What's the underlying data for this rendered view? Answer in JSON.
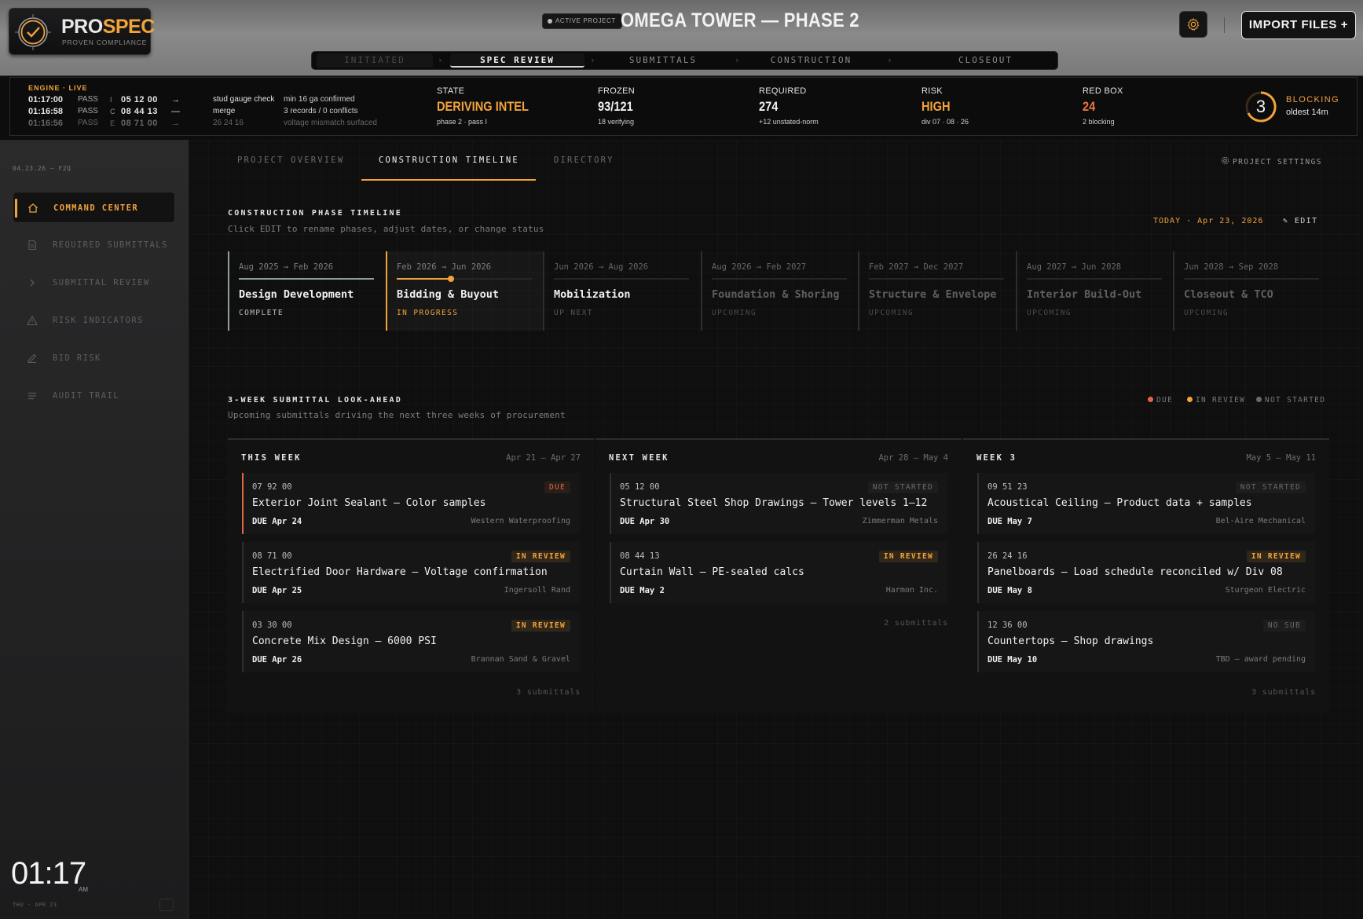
{
  "brand": {
    "name_a": "PRO",
    "name_b": "SPEC",
    "tagline": "PROVEN COMPLIANCE",
    "accent": "#f2a33a"
  },
  "header": {
    "active_badge": "ACTIVE PROJECT",
    "project_title": "OMEGA TOWER — PHASE 2",
    "import_label": "IMPORT FILES +",
    "settings_icon": "gear-icon"
  },
  "stepper": {
    "steps": [
      {
        "label": "INITIATED",
        "state": "done"
      },
      {
        "label": "SPEC REVIEW",
        "state": "active"
      },
      {
        "label": "SUBMITTALS",
        "state": "pending"
      },
      {
        "label": "CONSTRUCTION",
        "state": "pending"
      },
      {
        "label": "CLOSEOUT",
        "state": "pending"
      }
    ],
    "separator": "›"
  },
  "engine": {
    "label": "ENGINE · LIVE",
    "log": [
      {
        "time": "01:17:00",
        "status": "PASS",
        "code": "I",
        "num": "05 12 00",
        "arrow": "→",
        "msg": "stud gauge check",
        "detail": "min 16 ga confirmed"
      },
      {
        "time": "01:16:58",
        "status": "PASS",
        "code": "C",
        "num": "08 44 13",
        "arrow": "—",
        "msg": "merge",
        "detail": "3 records / 0 conflicts"
      },
      {
        "time": "01:16:56",
        "status": "PASS",
        "code": "E",
        "num": "08 71 00",
        "arrow": "→",
        "msg": "26 24 16",
        "detail": "voltage mismatch surfaced"
      }
    ]
  },
  "stats": [
    {
      "label": "STATE",
      "value": "DERIVING INTEL",
      "sub": "phase 2 · pass I",
      "tone": "orange"
    },
    {
      "label": "FROZEN",
      "value": "93/121",
      "sub": "18 verifying",
      "tone": "white"
    },
    {
      "label": "REQUIRED",
      "value": "274",
      "sub": "+12 unstated-norm",
      "tone": "white"
    },
    {
      "label": "RISK",
      "value": "HIGH",
      "sub": "div 07 · 08 · 26",
      "tone": "orange"
    },
    {
      "label": "RED BOX",
      "value": "24",
      "sub": "2 blocking",
      "tone": "red"
    }
  ],
  "blocking": {
    "count": "3",
    "label": "BLOCKING",
    "sub": "oldest 14m"
  },
  "sidebar": {
    "meta": "04.23.26 — F2Q",
    "items": [
      {
        "label": "COMMAND CENTER",
        "icon": "home-icon",
        "active": true
      },
      {
        "label": "REQUIRED SUBMITTALS",
        "icon": "document-icon",
        "active": false
      },
      {
        "label": "SUBMITTAL REVIEW",
        "icon": "chevron-right-icon",
        "active": false
      },
      {
        "label": "RISK INDICATORS",
        "icon": "warning-icon",
        "active": false
      },
      {
        "label": "BID RISK",
        "icon": "pencil-icon",
        "active": false
      },
      {
        "label": "AUDIT TRAIL",
        "icon": "list-icon",
        "active": false
      }
    ],
    "clock": {
      "time": "01:17",
      "ampm": "AM",
      "date": "THU · APR 23"
    }
  },
  "tabs": {
    "items": [
      "PROJECT OVERVIEW",
      "CONSTRUCTION TIMELINE",
      "DIRECTORY"
    ],
    "active": 1,
    "settings_label": "PROJECT SETTINGS"
  },
  "timeline": {
    "title": "CONSTRUCTION PHASE TIMELINE",
    "subtitle": "Click EDIT to rename phases, adjust dates, or change status",
    "today": "TODAY · Apr 23, 2026",
    "edit_label": "EDIT",
    "phases": [
      {
        "dates": "Aug 2025 → Feb 2026",
        "name": "Design Development",
        "status": "COMPLETE",
        "state": "complete",
        "progress": 1.0
      },
      {
        "dates": "Feb 2026 → Jun 2026",
        "name": "Bidding & Buyout",
        "status": "IN PROGRESS",
        "state": "active",
        "progress": 0.4
      },
      {
        "dates": "Jun 2026 → Aug 2026",
        "name": "Mobilization",
        "status": "UP NEXT",
        "state": "next",
        "progress": 0
      },
      {
        "dates": "Aug 2026 → Feb 2027",
        "name": "Foundation & Shoring",
        "status": "UPCOMING",
        "state": "upcoming",
        "progress": 0
      },
      {
        "dates": "Feb 2027 → Dec 2027",
        "name": "Structure & Envelope",
        "status": "UPCOMING",
        "state": "upcoming",
        "progress": 0
      },
      {
        "dates": "Aug 2027 → Jun 2028",
        "name": "Interior Build-Out",
        "status": "UPCOMING",
        "state": "upcoming",
        "progress": 0
      },
      {
        "dates": "Jun 2028 → Sep 2028",
        "name": "Closeout & TCO",
        "status": "UPCOMING",
        "state": "upcoming",
        "progress": 0
      }
    ]
  },
  "lookahead": {
    "title": "3-WEEK SUBMITTAL LOOK-AHEAD",
    "subtitle": "Upcoming submittals driving the next three weeks of procurement",
    "legend": [
      {
        "label": "DUE",
        "color": "#e0683e"
      },
      {
        "label": "IN REVIEW",
        "color": "#f2a33a"
      },
      {
        "label": "NOT STARTED",
        "color": "#6a6a6a"
      }
    ],
    "weeks": [
      {
        "title": "THIS WEEK",
        "range": "Apr 21 – Apr 27",
        "count": "3 submittals",
        "cards": [
          {
            "code": "07 92 00",
            "badge": "DUE",
            "kind": "due",
            "title": "Exterior Joint Sealant — Color samples",
            "due": "DUE Apr 24",
            "vendor": "Western Waterproofing"
          },
          {
            "code": "08 71 00",
            "badge": "IN REVIEW",
            "kind": "review",
            "title": "Electrified Door Hardware — Voltage confirmation",
            "due": "DUE Apr 25",
            "vendor": "Ingersoll Rand"
          },
          {
            "code": "03 30 00",
            "badge": "IN REVIEW",
            "kind": "review",
            "title": "Concrete Mix Design — 6000 PSI",
            "due": "DUE Apr 26",
            "vendor": "Brannan Sand & Gravel"
          }
        ]
      },
      {
        "title": "NEXT WEEK",
        "range": "Apr 28 – May 4",
        "count": "2 submittals",
        "cards": [
          {
            "code": "05 12 00",
            "badge": "NOT STARTED",
            "kind": "notstarted",
            "title": "Structural Steel Shop Drawings — Tower levels 1–12",
            "due": "DUE Apr 30",
            "vendor": "Zimmerman Metals"
          },
          {
            "code": "08 44 13",
            "badge": "IN REVIEW",
            "kind": "review",
            "title": "Curtain Wall — PE-sealed calcs",
            "due": "DUE May 2",
            "vendor": "Harmon Inc."
          }
        ]
      },
      {
        "title": "WEEK 3",
        "range": "May 5 – May 11",
        "count": "3 submittals",
        "cards": [
          {
            "code": "09 51 23",
            "badge": "NOT STARTED",
            "kind": "notstarted",
            "title": "Acoustical Ceiling — Product data + samples",
            "due": "DUE May 7",
            "vendor": "Bel-Aire Mechanical"
          },
          {
            "code": "26 24 16",
            "badge": "IN REVIEW",
            "kind": "review",
            "title": "Panelboards — Load schedule reconciled w/ Div 08",
            "due": "DUE May 8",
            "vendor": "Sturgeon Electric"
          },
          {
            "code": "12 36 00",
            "badge": "NO SUB",
            "kind": "notstarted",
            "title": "Countertops — Shop drawings",
            "due": "DUE May 10",
            "vendor": "TBD — award pending"
          }
        ]
      }
    ]
  }
}
